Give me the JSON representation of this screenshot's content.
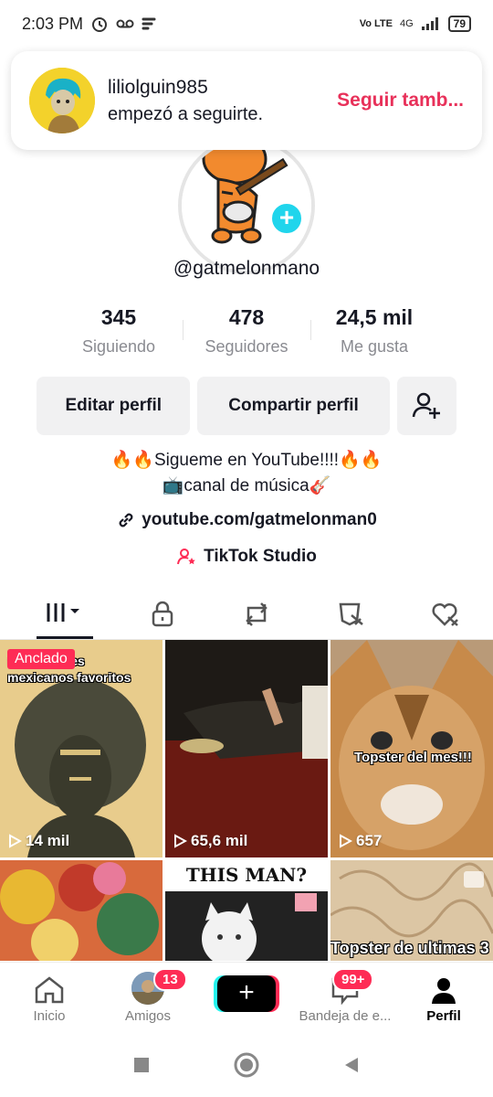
{
  "status_bar": {
    "time": "2:03 PM",
    "carrier": "Vo LTE",
    "network": "4G",
    "battery": "79"
  },
  "notification": {
    "username": "liliolguin985",
    "message": "empezó a seguirte.",
    "action": "Seguir tamb..."
  },
  "profile": {
    "username": "@gatmelonmano",
    "stats": [
      {
        "value": "345",
        "label": "Siguiendo"
      },
      {
        "value": "478",
        "label": "Seguidores"
      },
      {
        "value": "24,5 mil",
        "label": "Me gusta"
      }
    ],
    "edit_label": "Editar perfil",
    "share_label": "Compartir perfil",
    "bio_line1": "🔥🔥Sigueme en YouTube!!!!🔥🔥",
    "bio_line2": "📺canal de música🎸",
    "link": "youtube.com/gatmelonman0",
    "studio": "TikTok Studio"
  },
  "tabs": [
    "videos",
    "private",
    "reposts",
    "favorites",
    "liked"
  ],
  "videos": [
    {
      "views": "14 mil",
      "pinned": "Anclado",
      "caption": "mis álbumes mexicanos favoritos"
    },
    {
      "views": "65,6 mil"
    },
    {
      "views": "657",
      "caption": "Topster del mes!!!"
    },
    {
      "views": ""
    },
    {
      "views": "",
      "caption": "THIS MAN?"
    },
    {
      "views": "",
      "caption": "Topster de ultimas 3"
    }
  ],
  "bottom_nav": [
    {
      "label": "Inicio",
      "icon": "home-icon"
    },
    {
      "label": "Amigos",
      "badge": "13"
    },
    {
      "label": "",
      "icon": "plus-icon"
    },
    {
      "label": "Bandeja de e...",
      "badge": "99+"
    },
    {
      "label": "Perfil",
      "icon": "person-icon"
    }
  ],
  "colors": {
    "accent": "#fe2c55",
    "cyan": "#20d5ec"
  }
}
